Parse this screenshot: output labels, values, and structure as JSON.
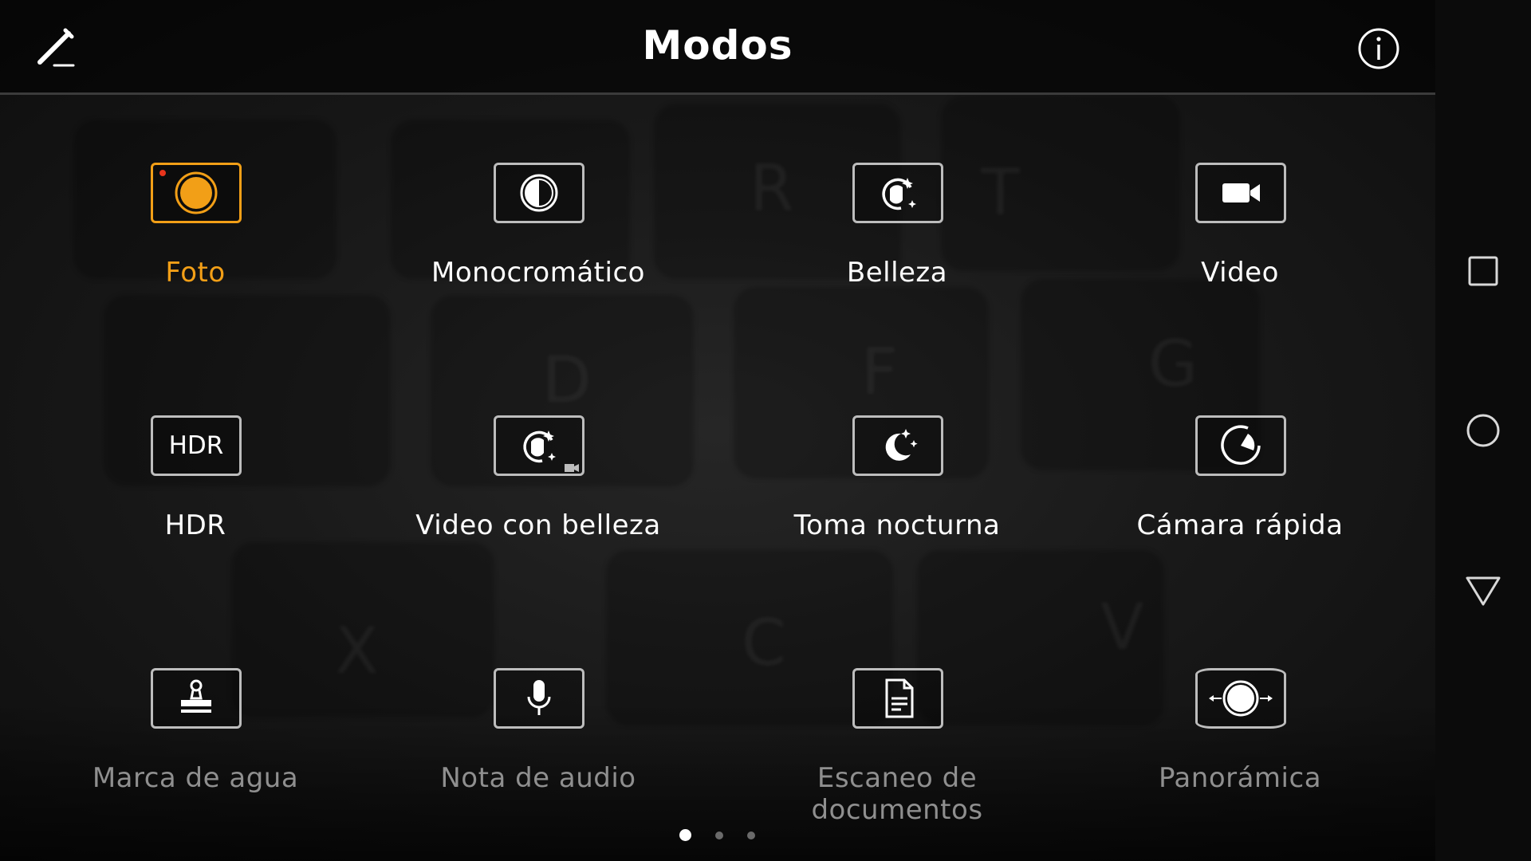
{
  "header": {
    "title": "Modos",
    "edit_icon": "pencil-icon",
    "info_icon": "info-icon"
  },
  "modes": [
    {
      "label": "Foto",
      "icon": "photo-shutter-icon",
      "state": "active"
    },
    {
      "label": "Monocromático",
      "icon": "monochrome-icon",
      "state": "normal"
    },
    {
      "label": "Belleza",
      "icon": "beauty-face-icon",
      "state": "normal"
    },
    {
      "label": "Video",
      "icon": "video-camera-icon",
      "state": "normal"
    },
    {
      "label": "HDR",
      "icon": "hdr-icon",
      "icon_text": "HDR",
      "state": "normal"
    },
    {
      "label": "Video con belleza",
      "icon": "beauty-video-icon",
      "state": "normal"
    },
    {
      "label": "Toma nocturna",
      "icon": "night-moon-icon",
      "state": "normal"
    },
    {
      "label": "Cámara rápida",
      "icon": "time-lapse-icon",
      "state": "normal"
    },
    {
      "label": "Marca de agua",
      "icon": "watermark-stamp-icon",
      "state": "dim"
    },
    {
      "label": "Nota de audio",
      "icon": "microphone-icon",
      "state": "dim"
    },
    {
      "label": "Escaneo de documentos",
      "icon": "document-scan-icon",
      "state": "dim"
    },
    {
      "label": "Panorámica",
      "icon": "panorama-icon",
      "state": "dim"
    }
  ],
  "pagination": {
    "pages": 3,
    "current": 1
  },
  "navbar": {
    "recents_icon": "square-recents-icon",
    "home_icon": "circle-home-icon",
    "back_icon": "triangle-back-icon"
  },
  "colors": {
    "accent": "#f29f17",
    "record_dot": "#e8341c",
    "text": "#ffffff",
    "dim_text": "#8f8f8f",
    "icon_border": "#bdbdbd"
  }
}
